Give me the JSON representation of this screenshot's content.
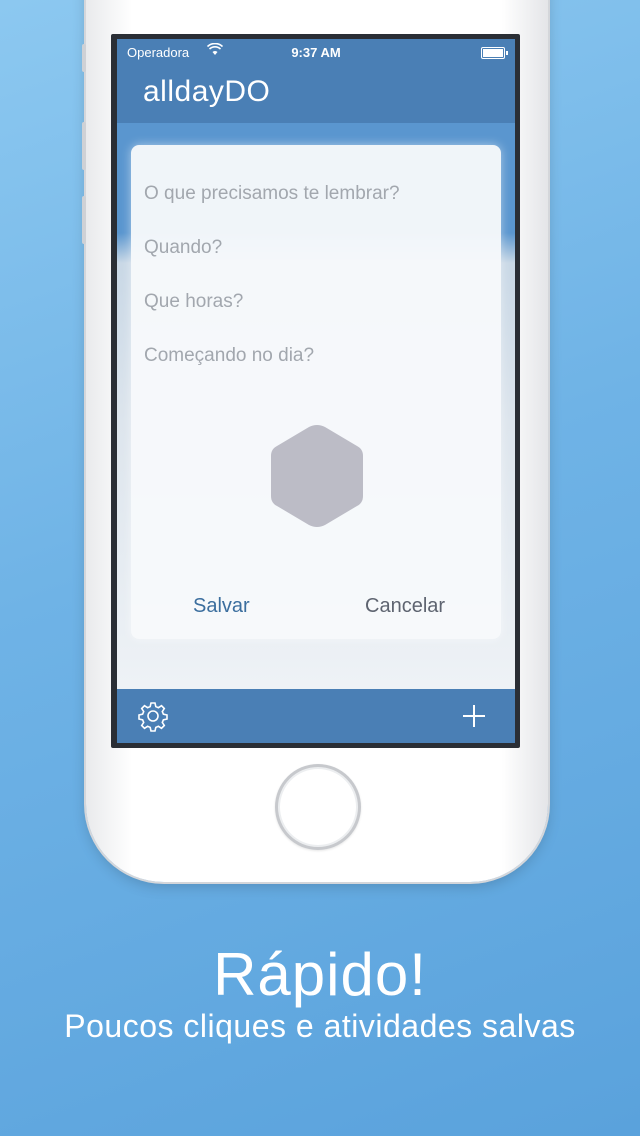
{
  "status_bar": {
    "carrier": "Operadora",
    "time": "9:37 AM",
    "wifi_icon": "wifi-icon",
    "battery_icon": "battery-icon"
  },
  "app": {
    "title": "alldayDO",
    "accent_color": "#4a7fb5"
  },
  "modal": {
    "fields": {
      "reminder_placeholder": "O que precisamos te lembrar?",
      "when_placeholder": "Quando?",
      "time_placeholder": "Que horas?",
      "start_placeholder": "Começando no dia?"
    },
    "icon_placeholder": "hexagon-icon",
    "save_label": "Salvar",
    "cancel_label": "Cancelar"
  },
  "toolbar": {
    "settings_icon": "gear-icon",
    "add_icon": "plus-icon"
  },
  "promo": {
    "headline": "Rápido!",
    "subline": "Poucos cliques e atividades salvas"
  }
}
